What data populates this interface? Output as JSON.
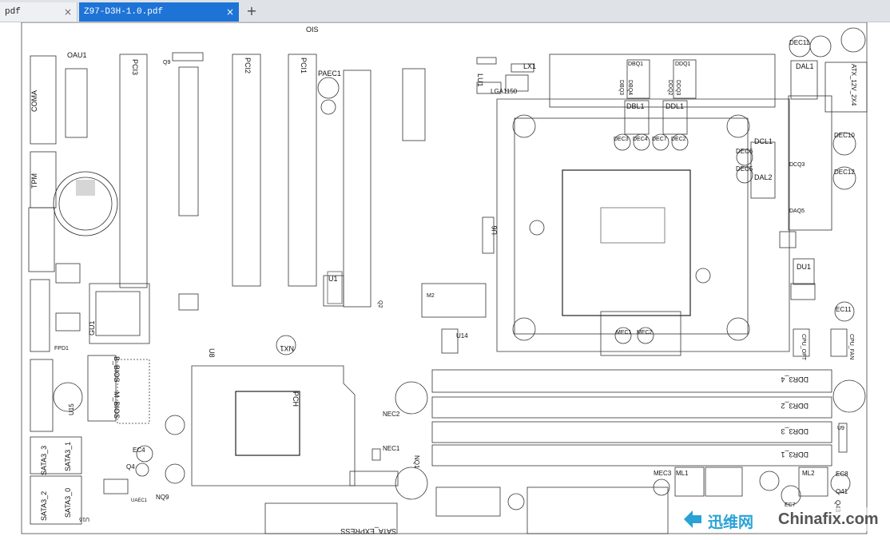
{
  "tabs": [
    {
      "label": "pdf",
      "close": "×"
    },
    {
      "label": "Z97-D3H-1.0.pdf",
      "close": "×"
    }
  ],
  "new_tab": "+",
  "labels": {
    "oau1": "OAU1",
    "pci3": "PCI3",
    "pci2": "PCI2",
    "pci1": "PCI1",
    "paec1": "PAEC1",
    "lx1": "LX1",
    "lu1": "LU1",
    "lga": "LGA1150",
    "dbq1": "DBQ1",
    "ddq1": "DDQ1",
    "dbq3": "DBQ3",
    "dbq4": "DBQ4",
    "ddq2": "DDQ2",
    "ddq3": "DDQ3",
    "dbl1": "DBL1",
    "ddl1": "DDL1",
    "dec11": "DEC11",
    "dal1": "DAL1",
    "atx12v": "ATX_12V_2X4",
    "coma": "COMA",
    "tpm": "TPM",
    "dec3": "DEC3",
    "dec4": "DEC4",
    "dec7": "DEC7",
    "dec2": "DEC2",
    "dcl1": "DCL1",
    "dec6": "DEC6",
    "dec5": "DEC5",
    "dal2": "DAL2",
    "dec10": "DEC10",
    "dec12": "DEC12",
    "dcq4": "DCQ4",
    "dcq3": "DCQ3",
    "dcq2": "DCQ2",
    "daq4": "DAQ4",
    "daq5": "DAQ5",
    "daq1": "DAQ1",
    "du1": "DU1",
    "u1": "U1",
    "u6": "U6",
    "m2": "M2",
    "ec11": "EC11",
    "u14": "U14",
    "u7": "U7",
    "mec1": "MEC1",
    "mec2": "MEC2",
    "sysfan1": "SYS_FAN1",
    "cpu_opt": "CPU_OPT",
    "cpu_fan": "CPU_FAN",
    "u17": "U17",
    "gu1": "GU1",
    "fpd1": "FPD1",
    "nx1": "NX1",
    "u8": "U8",
    "bbios": "B_BIOS",
    "mbios": "M_BIOS",
    "pch": "PCH",
    "u15": "U15",
    "ddr3_4": "DDR3_4",
    "ddr3_2": "DDR3_2",
    "ddr3_3": "DDR3_3",
    "ddr3_1": "DDR3_1",
    "nec2": "NEC2",
    "nq2": "NQ2",
    "nq2s": "NQ2S",
    "nec1": "NEC1",
    "nq1": "NQ1",
    "sata3_3": "SATA3_3",
    "sata3_1": "SATA3_1",
    "sata3_2": "SATA3_2",
    "sata3_0": "SATA3_0",
    "ec4": "EC4",
    "q4": "Q4",
    "nq9": "NQ9",
    "uaec1": "UAEC1",
    "u16": "U16",
    "sata_express": "SATA_EXPRESS",
    "mec3": "MEC3",
    "ml1": "ML1",
    "ml2": "ML2",
    "ec8": "EC8",
    "q41": "Q41",
    "q43": "Q43",
    "ec7": "EC7",
    "u9": "U9",
    "ois": "OIS",
    "q9": "Q9",
    "q2": "Q2"
  },
  "watermark": {
    "cn": "迅维网",
    "en": "Chinafix.com"
  }
}
